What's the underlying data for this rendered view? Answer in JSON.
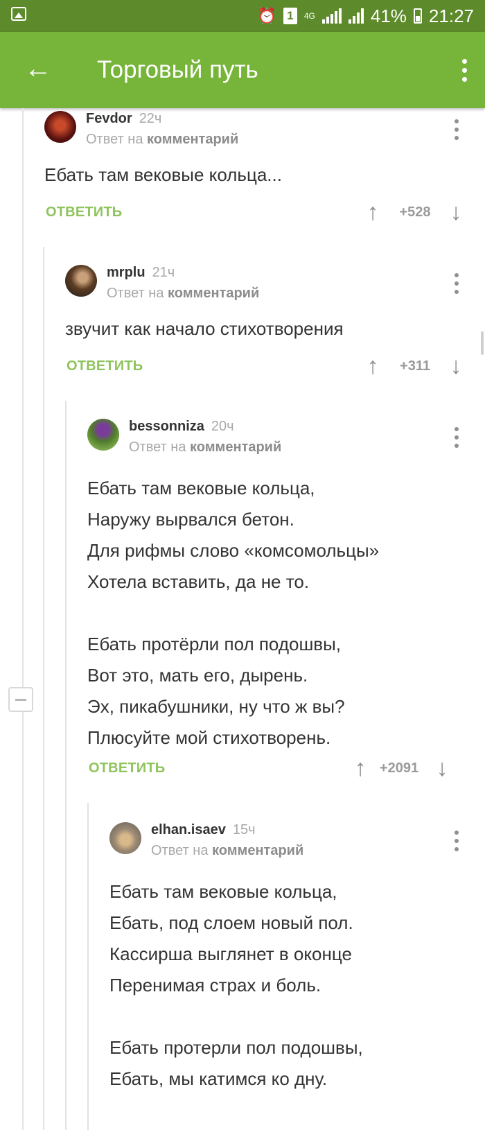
{
  "status_bar": {
    "sim": "1",
    "network": "4G",
    "battery": "41%",
    "time": "21:27"
  },
  "app_bar": {
    "title": "Торговый путь"
  },
  "comments": [
    {
      "author": "Fevdor",
      "time": "22ч",
      "reply_prefix": "Ответ на",
      "reply_target": "комментарий",
      "text": "Ебать там вековые кольца...",
      "reply_label": "ОТВЕТИТЬ",
      "rating": "+528"
    },
    {
      "author": "mrplu",
      "time": "21ч",
      "reply_prefix": "Ответ на",
      "reply_target": "комментарий",
      "text": "звучит как начало стихотворения",
      "reply_label": "ОТВЕТИТЬ",
      "rating": "+311"
    },
    {
      "author": "bessonniza",
      "time": "20ч",
      "reply_prefix": "Ответ на",
      "reply_target": "комментарий",
      "text": "Ебать там вековые кольца,\nНаружу вырвался бетон.\nДля рифмы слово «комсомольцы»\nХотела вставить, да не то.\n\nЕбать протёрли пол подошвы,\nВот это, мать его, дырень.\nЭх, пикабушники, ну что ж вы?\nПлюсуйте мой стихотворень.",
      "reply_label": "ОТВЕТИТЬ",
      "rating": "+2091"
    },
    {
      "author": "elhan.isaev",
      "time": "15ч",
      "reply_prefix": "Ответ на",
      "reply_target": "комментарий",
      "text": "Ебать там вековые кольца,\nЕбать, под слоем новый пол.\nКассирша выглянет в оконце\nПеренимая страх и боль.\n\nЕбать протерли пол подошвы,\nЕбать, мы катимся ко дну."
    }
  ]
}
